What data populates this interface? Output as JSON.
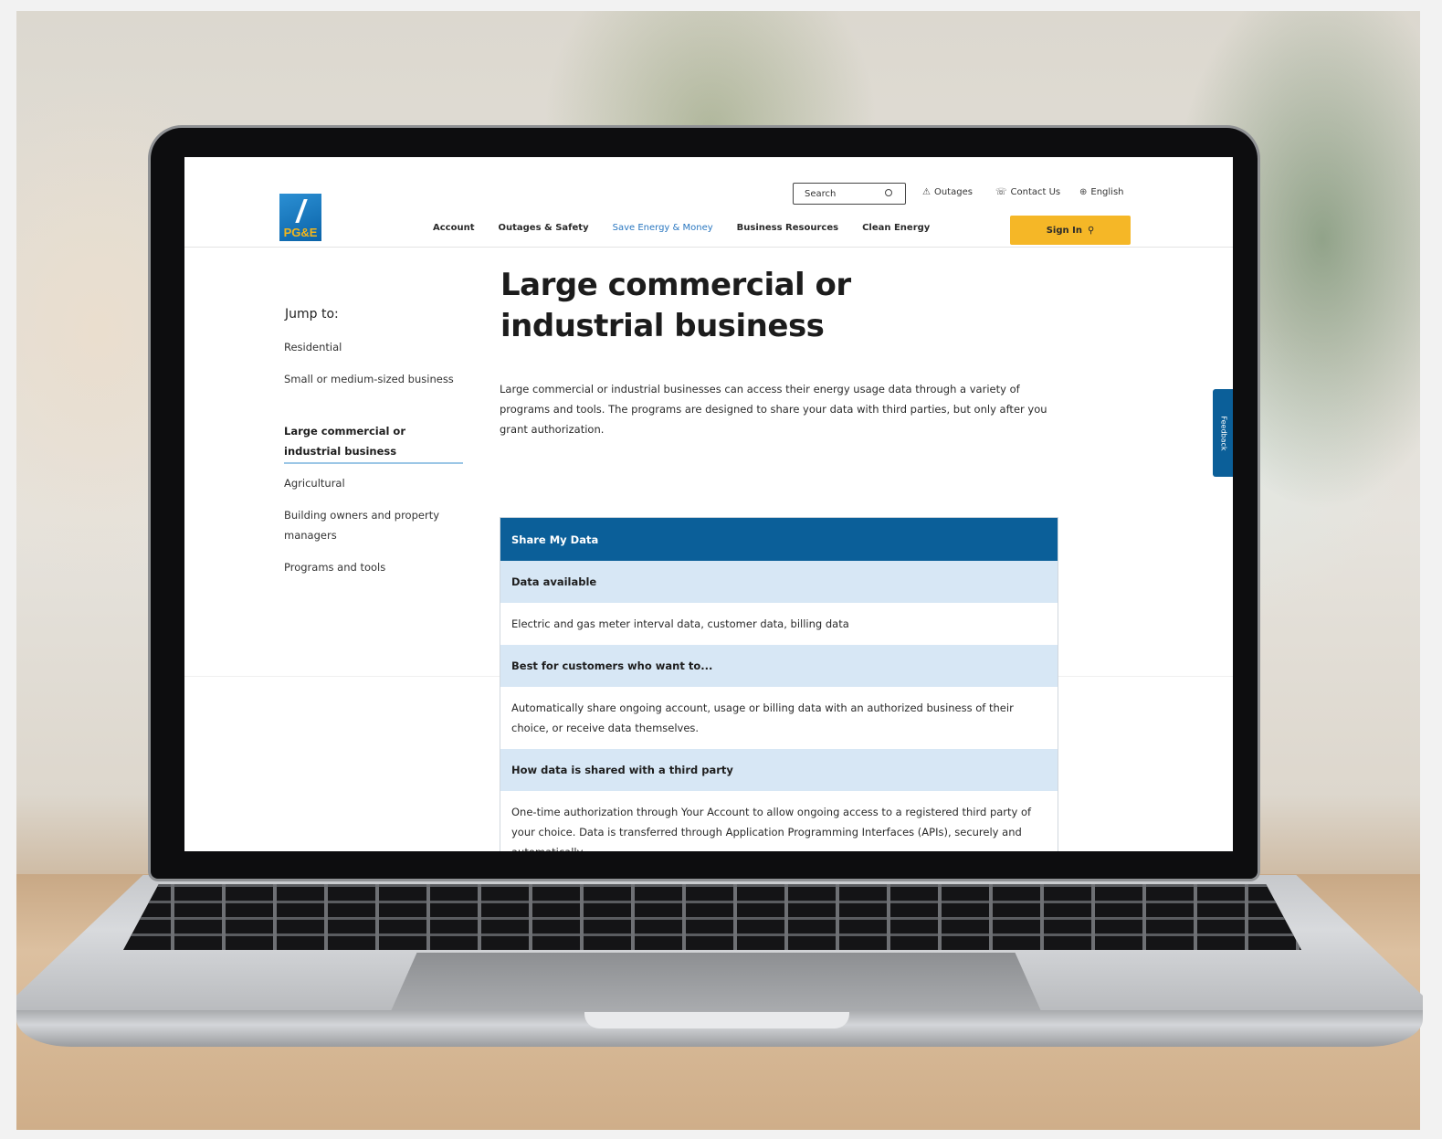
{
  "site": {
    "logo_text": "PG&E"
  },
  "header": {
    "search_placeholder": "Search",
    "utility_links": [
      {
        "label": "Outages",
        "icon": "warning-triangle-icon"
      },
      {
        "label": "Contact Us",
        "icon": "phone-icon"
      },
      {
        "label": "English",
        "icon": "globe-icon"
      }
    ],
    "nav": [
      {
        "label": "Account",
        "active": false
      },
      {
        "label": "Outages & Safety",
        "active": false
      },
      {
        "label": "Save Energy & Money",
        "active": true
      },
      {
        "label": "Business Resources",
        "active": false
      },
      {
        "label": "Clean Energy",
        "active": false
      }
    ],
    "signin_label": "Sign In",
    "signin_icon": "user-icon"
  },
  "sidebar": {
    "jump_label": "Jump to:",
    "items": [
      {
        "label": "Residential"
      },
      {
        "label": "Small or medium-sized business"
      },
      {
        "label": "Large commercial or industrial business",
        "selected": true
      },
      {
        "label": "Agricultural"
      },
      {
        "label": "Building owners and property managers"
      },
      {
        "label": "Programs and tools"
      }
    ]
  },
  "main": {
    "title": "Large commercial or industrial business",
    "intro": "Large commercial or industrial businesses can access their energy usage data through a variety of programs and tools. The programs are designed to share your data with third parties, but only after you grant authorization.",
    "table": {
      "heading": "Share My Data",
      "rows": [
        {
          "label": "Data available",
          "value": "Electric and gas meter interval data, customer data, billing data"
        },
        {
          "label": "Best for customers who want to...",
          "value": "Automatically share ongoing account, usage or billing data with an authorized business of their choice, or receive data themselves."
        },
        {
          "label": "How data is shared with a third party",
          "value": "One-time authorization through Your Account to allow ongoing access to a registered third party of your choice. Data is transferred through Application Programming Interfaces (APIs), securely and automatically."
        }
      ]
    }
  },
  "feedback_label": "Feedback",
  "colors": {
    "brand_blue": "#0b5f99",
    "accent_yellow": "#f5b727",
    "label_row_bg": "#d7e7f5",
    "active_nav": "#2a77c0"
  }
}
